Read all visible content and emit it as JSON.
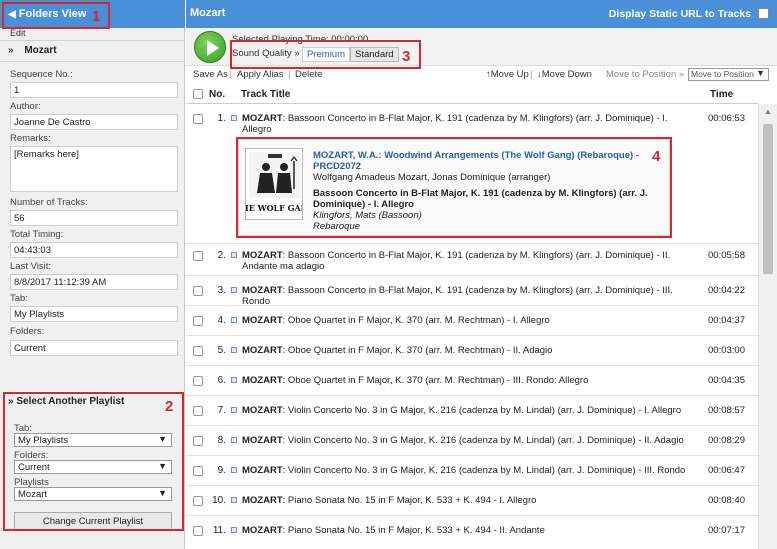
{
  "left": {
    "folders_view": "Folders View",
    "edit": "Edit",
    "playlist_name": "Mozart",
    "fields": [
      {
        "label": "Sequence No.:",
        "value": "1"
      },
      {
        "label": "Author:",
        "value": "Joanne De Castro"
      },
      {
        "label": "Remarks:",
        "value": "[Remarks here]"
      },
      {
        "label": "Number of Tracks:",
        "value": "56"
      },
      {
        "label": "Total Timing:",
        "value": "04:43:03"
      },
      {
        "label": "Last Visit:",
        "value": "8/8/2017 11:12:39 AM"
      },
      {
        "label": "Tab:",
        "value": "My Playlists"
      },
      {
        "label": "Folders:",
        "value": "Current"
      }
    ],
    "select_another": {
      "title": "Select Another Playlist",
      "tab_label": "Tab:",
      "tab_value": "My Playlists",
      "folders_label": "Folders:",
      "folders_value": "Current",
      "playlists_label": "Playlists",
      "playlists_value": "Mozart",
      "button": "Change Current Playlist"
    }
  },
  "header": {
    "playlist_title": "Mozart",
    "static_url": "Display Static URL to Tracks"
  },
  "controls": {
    "selected_time": "Selected Playing Time: 00:00:00",
    "sound_quality": "Sound Quality »",
    "premium": "Premium",
    "standard": "Standard"
  },
  "toolbar": {
    "save_as": "Save As",
    "apply_alias": "Apply Alias",
    "delete": "Delete",
    "move_up": "↑Move Up",
    "move_down": "↓Move Down",
    "move_to_position": "Move to Position »",
    "move_select": "Move to Position"
  },
  "table": {
    "headers": {
      "no": "No.",
      "title": "Track Title",
      "time": "Time"
    },
    "rows": [
      {
        "no": "1.",
        "composer": "MOZART",
        "title": ": Bassoon Concerto in B-Flat Major, K. 191 (cadenza by M. Klingfors) (arr. J. Dominique) - I. Allegro",
        "time": "00:06:53"
      },
      {
        "no": "2.",
        "composer": "MOZART",
        "title": ": Bassoon Concerto in B-Flat Major, K. 191 (cadenza by M. Klingfors) (arr. J. Dominique) - II. Andante ma adagio",
        "time": "00:05:58"
      },
      {
        "no": "3.",
        "composer": "MOZART",
        "title": ": Bassoon Concerto in B-Flat Major, K. 191 (cadenza by M. Klingfors) (arr. J. Dominique) - III. Rondo",
        "time": "00:04:22"
      },
      {
        "no": "4.",
        "composer": "MOZART",
        "title": ": Oboe Quartet in F Major, K. 370 (arr. M. Rechtman) - I. Allegro",
        "time": "00:04:37"
      },
      {
        "no": "5.",
        "composer": "MOZART",
        "title": ": Oboe Quartet in F Major, K. 370 (arr. M. Rechtman) - II. Adagio",
        "time": "00:03:00"
      },
      {
        "no": "6.",
        "composer": "MOZART",
        "title": ": Oboe Quartet in F Major, K. 370 (arr. M. Rechtman) - III. Rondo: Allegro",
        "time": "00:04:35"
      },
      {
        "no": "7.",
        "composer": "MOZART",
        "title": ": Violin Concerto No. 3 in G Major, K. 216 (cadenza by M. Lindal) (arr. J. Dominique) - I. Allegro",
        "time": "00:08:57"
      },
      {
        "no": "8.",
        "composer": "MOZART",
        "title": ": Violin Concerto No. 3 in G Major, K. 216 (cadenza by M. Lindal) (arr. J. Dominique) - II. Adagio",
        "time": "00:08:29"
      },
      {
        "no": "9.",
        "composer": "MOZART",
        "title": ": Violin Concerto No. 3 in G Major, K. 216 (cadenza by M. Lindal) (arr. J. Dominique) - III. Rondo",
        "time": "00:06:47"
      },
      {
        "no": "10.",
        "composer": "MOZART",
        "title": ": Piano Sonata No. 15 in F Major, K. 533 + K. 494 - I. Allegro",
        "time": "00:08:40"
      },
      {
        "no": "11.",
        "composer": "MOZART",
        "title": ": Piano Sonata No. 15 in F Major, K. 533 + K. 494 - II. Andante",
        "time": "00:07:17"
      }
    ]
  },
  "detail": {
    "album": "MOZART, W.A.: Woodwind Arrangements (The Wolf Gang) (Rebaroque) - PRCD2072",
    "artists": "Wolfgang Amadeus Mozart, Jonas Dominique (arranger)",
    "track": "Bassoon Concerto in B-Flat Major, K. 191 (cadenza by M. Klingfors) (arr. J. Dominique) - I. Allegro",
    "performer": "Klingfors, Mats (Bassoon)",
    "ensemble": "Rebaroque",
    "cover_text": "THE WOLF GANG"
  },
  "annotations": [
    "1",
    "2",
    "3",
    "4"
  ],
  "colors": {
    "header_blue": "#4a90d9",
    "annotation_red": "#d9262b",
    "link_blue": "#2a5db0",
    "play_green": "#4caf2e"
  }
}
